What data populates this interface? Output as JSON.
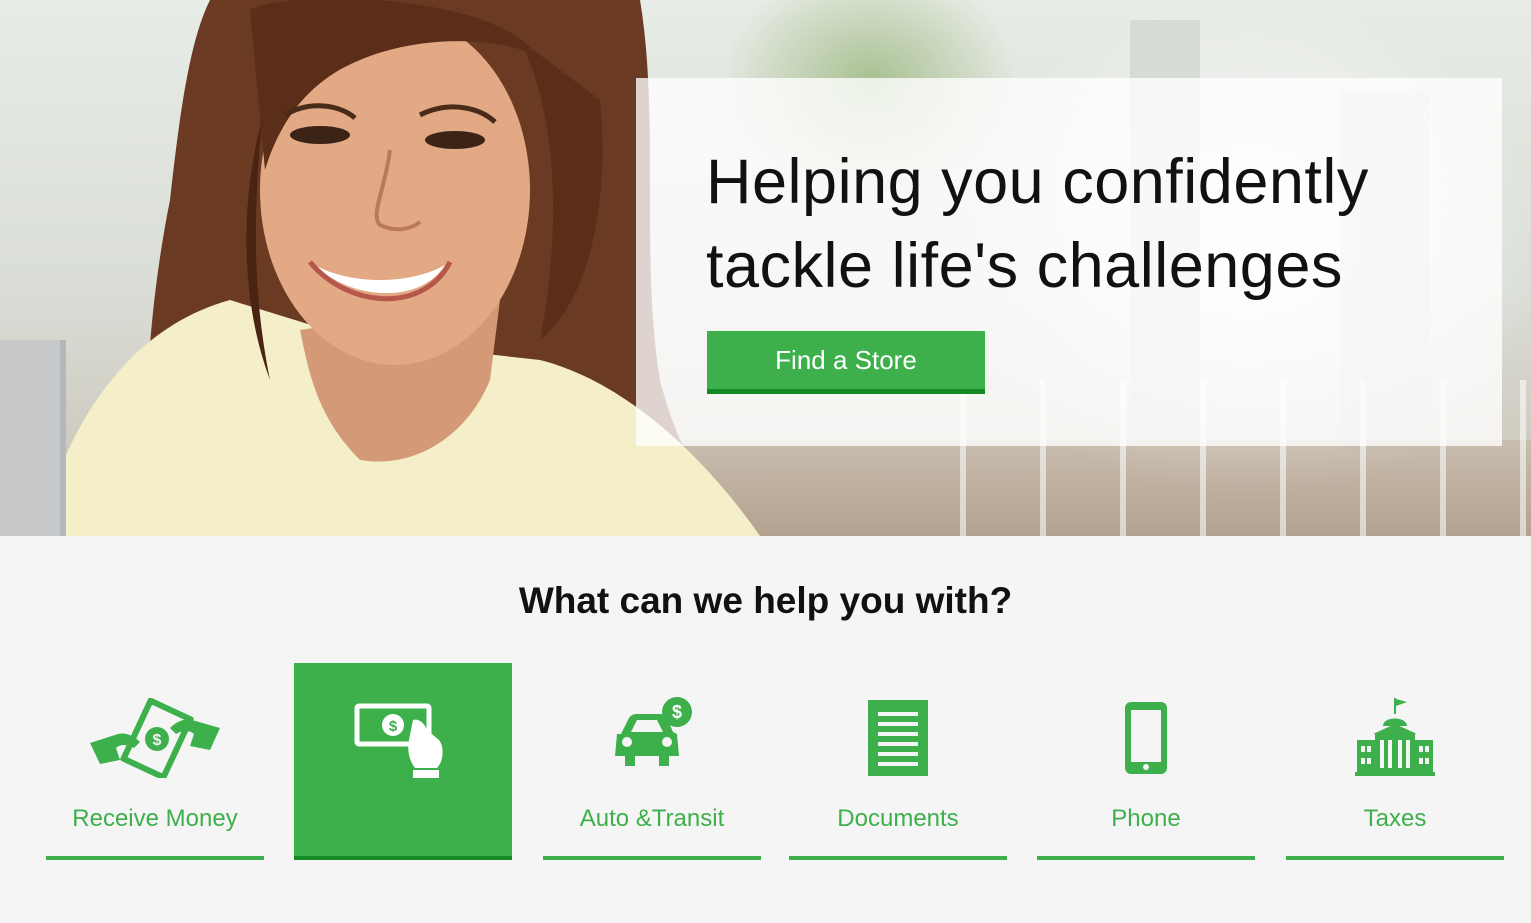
{
  "hero": {
    "headline_line1": "Helping you confidently",
    "headline_line2": "tackle life's challenges",
    "cta_label": "Find a Store"
  },
  "help": {
    "title": "What can we help you with?",
    "tiles": [
      {
        "label": "Receive Money",
        "icon": "money-handoff-icon",
        "active": false
      },
      {
        "label": "",
        "icon": "bill-payment-icon",
        "active": true
      },
      {
        "label": "Auto &Transit",
        "icon": "car-dollar-icon",
        "active": false
      },
      {
        "label": "Documents",
        "icon": "document-icon",
        "active": false
      },
      {
        "label": "Phone",
        "icon": "phone-icon",
        "active": false
      },
      {
        "label": "Taxes",
        "icon": "government-building-icon",
        "active": false
      }
    ]
  },
  "colors": {
    "brand_green": "#3db04b",
    "brand_green_dark": "#138a24",
    "section_background": "#f5f5f5"
  }
}
